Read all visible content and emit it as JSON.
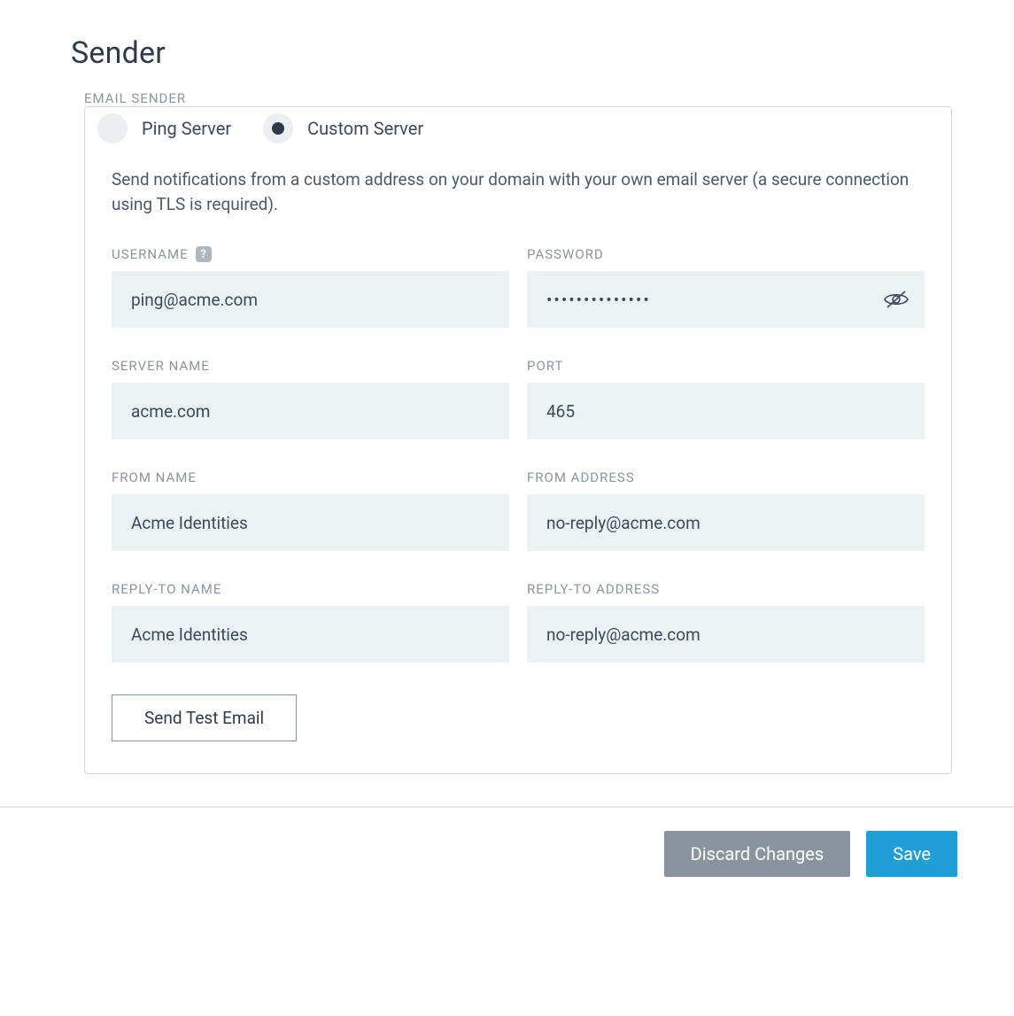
{
  "title": "Sender",
  "sectionLabel": "EMAIL SENDER",
  "radios": {
    "ping": "Ping Server",
    "custom": "Custom Server",
    "selected": "custom"
  },
  "description": "Send notifications from a custom address on your domain with your own email server (a secure connection using TLS is required).",
  "fields": {
    "username": {
      "label": "USERNAME",
      "value": "ping@acme.com"
    },
    "password": {
      "label": "PASSWORD",
      "value": "••••••••••••••"
    },
    "serverName": {
      "label": "SERVER NAME",
      "value": "acme.com"
    },
    "port": {
      "label": "PORT",
      "value": "465"
    },
    "fromName": {
      "label": "FROM NAME",
      "value": "Acme Identities"
    },
    "fromAddress": {
      "label": "FROM ADDRESS",
      "value": "no-reply@acme.com"
    },
    "replyToName": {
      "label": "REPLY-TO NAME",
      "value": "Acme Identities"
    },
    "replyToAddress": {
      "label": "REPLY-TO ADDRESS",
      "value": "no-reply@acme.com"
    }
  },
  "helpGlyph": "?",
  "buttons": {
    "sendTest": "Send Test Email",
    "discard": "Discard Changes",
    "save": "Save"
  }
}
